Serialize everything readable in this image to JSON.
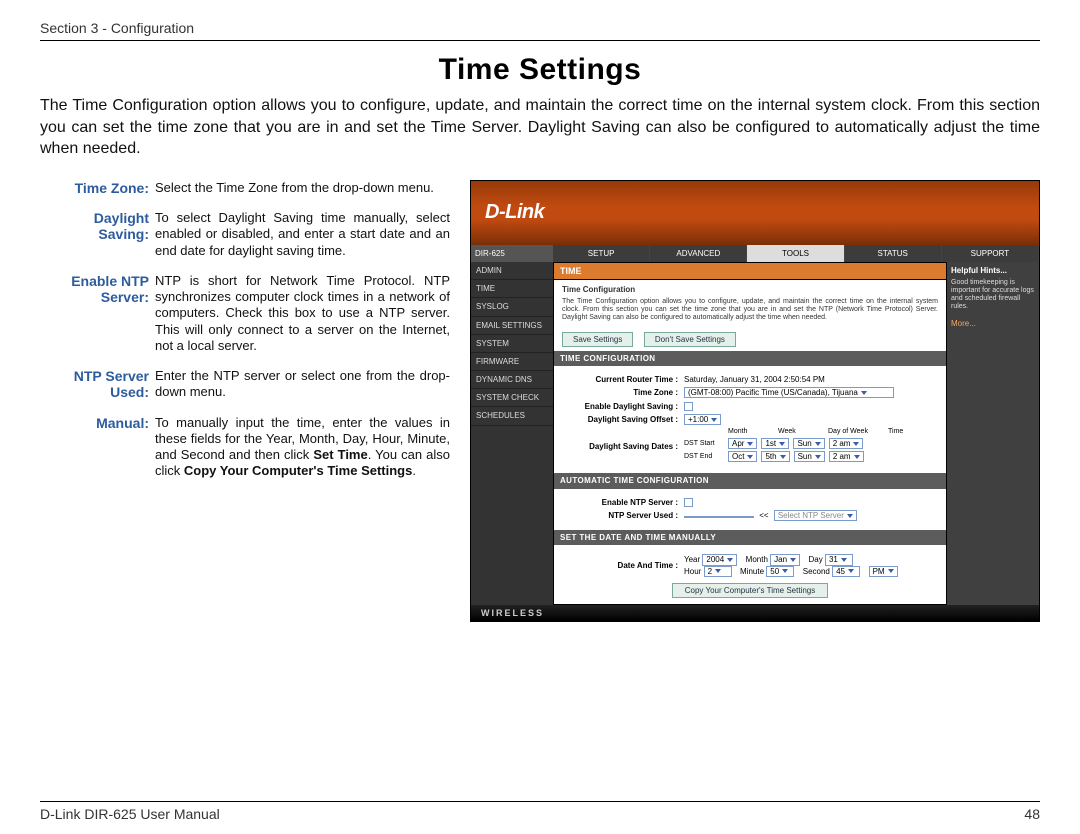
{
  "header": {
    "section": "Section 3 - Configuration"
  },
  "title": "Time Settings",
  "intro": "The Time Configuration option allows you to configure, update, and maintain the correct time on the internal system clock. From this section you can set the time zone that you are in and set the Time Server. Daylight Saving can also be configured to automatically adjust the time when needed.",
  "defs": {
    "timezone": {
      "label": "Time Zone:",
      "desc": "Select the Time Zone from the drop-down menu."
    },
    "daylight": {
      "label": "Daylight Saving:",
      "desc": "To select Daylight Saving time manually, select enabled or disabled, and enter a start date and an end date for daylight saving time."
    },
    "enablentp_label_a": "Enable NTP",
    "enablentp_label_b": "Server:",
    "enablentp_desc": "NTP is short for Network Time Protocol. NTP synchronizes computer clock times in a network of computers. Check this box to use a NTP server. This will only connect to a server on the Internet, not a local server.",
    "ntpused": {
      "label": "NTP Server Used:",
      "desc": "Enter the NTP server or select one from the drop-down menu."
    },
    "manual_label": "Manual:",
    "manual_a": "To manually input the time, enter the values in these fields for the Year, Month, Day, Hour, Minute, and Second and then click ",
    "manual_b": "Set Time",
    "manual_c": ". You can also click ",
    "manual_d": "Copy Your Computer's Time Settings",
    "manual_e": "."
  },
  "router": {
    "brand": "D-Link",
    "model": "DIR-625",
    "sidenav": [
      "ADMIN",
      "TIME",
      "SYSLOG",
      "EMAIL SETTINGS",
      "SYSTEM",
      "FIRMWARE",
      "DYNAMIC DNS",
      "SYSTEM CHECK",
      "SCHEDULES"
    ],
    "tabs": [
      "SETUP",
      "ADVANCED",
      "TOOLS",
      "STATUS",
      "SUPPORT"
    ],
    "active_tab": "TOOLS",
    "hints": {
      "title": "Helpful Hints...",
      "text": "Good timekeeping is important for accurate logs and scheduled firewall rules.",
      "more": "More..."
    },
    "section1": {
      "title": "TIME",
      "subhead": "Time Configuration",
      "para": "The Time Configuration option allows you to configure, update, and maintain the correct time on the internal system clock. From this section you can set the time zone that you are in and set the NTP (Network Time Protocol) Server. Daylight Saving can also be configured to automatically adjust the time when needed.",
      "save": "Save Settings",
      "dont": "Don't Save Settings"
    },
    "timecfg": {
      "bar": "TIME CONFIGURATION",
      "crt_label": "Current Router Time :",
      "crt_value": "Saturday, January 31, 2004 2:50:54 PM",
      "tz_label": "Time Zone :",
      "tz_value": "(GMT-08:00) Pacific Time (US/Canada), Tijuana",
      "eds_label": "Enable Daylight Saving :",
      "dso_label": "Daylight Saving Offset :",
      "dso_value": "+1:00",
      "dsd_label": "Daylight Saving Dates :",
      "col_month": "Month",
      "col_week": "Week",
      "col_dow": "Day of Week",
      "col_time": "Time",
      "start_label": "DST Start",
      "start_month": "Apr",
      "start_week": "1st",
      "start_dow": "Sun",
      "start_time": "2 am",
      "end_label": "DST End",
      "end_month": "Oct",
      "end_week": "5th",
      "end_dow": "Sun",
      "end_time": "2 am"
    },
    "auto": {
      "bar": "AUTOMATIC TIME CONFIGURATION",
      "ens_label": "Enable NTP Server :",
      "ntpused_label": "NTP Server Used :",
      "ntp_placeholder": "Select NTP Server",
      "ntp_prefix": "<<"
    },
    "manual": {
      "bar": "SET THE DATE AND TIME MANUALLY",
      "date_label": "Date And Time :",
      "year_l": "Year",
      "year_v": "2004",
      "month_l": "Month",
      "month_v": "Jan",
      "day_l": "Day",
      "day_v": "31",
      "hour_l": "Hour",
      "hour_v": "2",
      "minute_l": "Minute",
      "minute_v": "50",
      "second_l": "Second",
      "second_v": "45",
      "ampm": "PM",
      "copy_btn": "Copy Your Computer's Time Settings"
    },
    "footer": "WIRELESS"
  },
  "footer": {
    "left": "D-Link DIR-625 User Manual",
    "right": "48"
  }
}
